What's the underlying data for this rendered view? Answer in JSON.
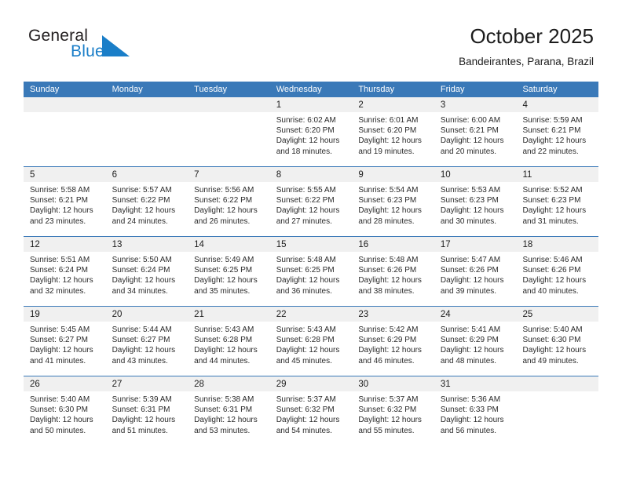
{
  "brand": {
    "word_one": "General",
    "word_two": "Blue",
    "triangle_color": "#1a7ec8"
  },
  "header": {
    "title": "October 2025",
    "subtitle": "Bandeirantes, Parana, Brazil"
  },
  "theme": {
    "header_blue": "#3a79b8",
    "day_band_gray": "#f0f0f0",
    "text_dark": "#1c1c1c"
  },
  "weekdays": [
    "Sunday",
    "Monday",
    "Tuesday",
    "Wednesday",
    "Thursday",
    "Friday",
    "Saturday"
  ],
  "weeks": [
    [
      {
        "empty": true
      },
      {
        "empty": true
      },
      {
        "empty": true
      },
      {
        "day": "1",
        "sunrise": "Sunrise: 6:02 AM",
        "sunset": "Sunset: 6:20 PM",
        "daylight1": "Daylight: 12 hours",
        "daylight2": "and 18 minutes."
      },
      {
        "day": "2",
        "sunrise": "Sunrise: 6:01 AM",
        "sunset": "Sunset: 6:20 PM",
        "daylight1": "Daylight: 12 hours",
        "daylight2": "and 19 minutes."
      },
      {
        "day": "3",
        "sunrise": "Sunrise: 6:00 AM",
        "sunset": "Sunset: 6:21 PM",
        "daylight1": "Daylight: 12 hours",
        "daylight2": "and 20 minutes."
      },
      {
        "day": "4",
        "sunrise": "Sunrise: 5:59 AM",
        "sunset": "Sunset: 6:21 PM",
        "daylight1": "Daylight: 12 hours",
        "daylight2": "and 22 minutes."
      }
    ],
    [
      {
        "day": "5",
        "sunrise": "Sunrise: 5:58 AM",
        "sunset": "Sunset: 6:21 PM",
        "daylight1": "Daylight: 12 hours",
        "daylight2": "and 23 minutes."
      },
      {
        "day": "6",
        "sunrise": "Sunrise: 5:57 AM",
        "sunset": "Sunset: 6:22 PM",
        "daylight1": "Daylight: 12 hours",
        "daylight2": "and 24 minutes."
      },
      {
        "day": "7",
        "sunrise": "Sunrise: 5:56 AM",
        "sunset": "Sunset: 6:22 PM",
        "daylight1": "Daylight: 12 hours",
        "daylight2": "and 26 minutes."
      },
      {
        "day": "8",
        "sunrise": "Sunrise: 5:55 AM",
        "sunset": "Sunset: 6:22 PM",
        "daylight1": "Daylight: 12 hours",
        "daylight2": "and 27 minutes."
      },
      {
        "day": "9",
        "sunrise": "Sunrise: 5:54 AM",
        "sunset": "Sunset: 6:23 PM",
        "daylight1": "Daylight: 12 hours",
        "daylight2": "and 28 minutes."
      },
      {
        "day": "10",
        "sunrise": "Sunrise: 5:53 AM",
        "sunset": "Sunset: 6:23 PM",
        "daylight1": "Daylight: 12 hours",
        "daylight2": "and 30 minutes."
      },
      {
        "day": "11",
        "sunrise": "Sunrise: 5:52 AM",
        "sunset": "Sunset: 6:23 PM",
        "daylight1": "Daylight: 12 hours",
        "daylight2": "and 31 minutes."
      }
    ],
    [
      {
        "day": "12",
        "sunrise": "Sunrise: 5:51 AM",
        "sunset": "Sunset: 6:24 PM",
        "daylight1": "Daylight: 12 hours",
        "daylight2": "and 32 minutes."
      },
      {
        "day": "13",
        "sunrise": "Sunrise: 5:50 AM",
        "sunset": "Sunset: 6:24 PM",
        "daylight1": "Daylight: 12 hours",
        "daylight2": "and 34 minutes."
      },
      {
        "day": "14",
        "sunrise": "Sunrise: 5:49 AM",
        "sunset": "Sunset: 6:25 PM",
        "daylight1": "Daylight: 12 hours",
        "daylight2": "and 35 minutes."
      },
      {
        "day": "15",
        "sunrise": "Sunrise: 5:48 AM",
        "sunset": "Sunset: 6:25 PM",
        "daylight1": "Daylight: 12 hours",
        "daylight2": "and 36 minutes."
      },
      {
        "day": "16",
        "sunrise": "Sunrise: 5:48 AM",
        "sunset": "Sunset: 6:26 PM",
        "daylight1": "Daylight: 12 hours",
        "daylight2": "and 38 minutes."
      },
      {
        "day": "17",
        "sunrise": "Sunrise: 5:47 AM",
        "sunset": "Sunset: 6:26 PM",
        "daylight1": "Daylight: 12 hours",
        "daylight2": "and 39 minutes."
      },
      {
        "day": "18",
        "sunrise": "Sunrise: 5:46 AM",
        "sunset": "Sunset: 6:26 PM",
        "daylight1": "Daylight: 12 hours",
        "daylight2": "and 40 minutes."
      }
    ],
    [
      {
        "day": "19",
        "sunrise": "Sunrise: 5:45 AM",
        "sunset": "Sunset: 6:27 PM",
        "daylight1": "Daylight: 12 hours",
        "daylight2": "and 41 minutes."
      },
      {
        "day": "20",
        "sunrise": "Sunrise: 5:44 AM",
        "sunset": "Sunset: 6:27 PM",
        "daylight1": "Daylight: 12 hours",
        "daylight2": "and 43 minutes."
      },
      {
        "day": "21",
        "sunrise": "Sunrise: 5:43 AM",
        "sunset": "Sunset: 6:28 PM",
        "daylight1": "Daylight: 12 hours",
        "daylight2": "and 44 minutes."
      },
      {
        "day": "22",
        "sunrise": "Sunrise: 5:43 AM",
        "sunset": "Sunset: 6:28 PM",
        "daylight1": "Daylight: 12 hours",
        "daylight2": "and 45 minutes."
      },
      {
        "day": "23",
        "sunrise": "Sunrise: 5:42 AM",
        "sunset": "Sunset: 6:29 PM",
        "daylight1": "Daylight: 12 hours",
        "daylight2": "and 46 minutes."
      },
      {
        "day": "24",
        "sunrise": "Sunrise: 5:41 AM",
        "sunset": "Sunset: 6:29 PM",
        "daylight1": "Daylight: 12 hours",
        "daylight2": "and 48 minutes."
      },
      {
        "day": "25",
        "sunrise": "Sunrise: 5:40 AM",
        "sunset": "Sunset: 6:30 PM",
        "daylight1": "Daylight: 12 hours",
        "daylight2": "and 49 minutes."
      }
    ],
    [
      {
        "day": "26",
        "sunrise": "Sunrise: 5:40 AM",
        "sunset": "Sunset: 6:30 PM",
        "daylight1": "Daylight: 12 hours",
        "daylight2": "and 50 minutes."
      },
      {
        "day": "27",
        "sunrise": "Sunrise: 5:39 AM",
        "sunset": "Sunset: 6:31 PM",
        "daylight1": "Daylight: 12 hours",
        "daylight2": "and 51 minutes."
      },
      {
        "day": "28",
        "sunrise": "Sunrise: 5:38 AM",
        "sunset": "Sunset: 6:31 PM",
        "daylight1": "Daylight: 12 hours",
        "daylight2": "and 53 minutes."
      },
      {
        "day": "29",
        "sunrise": "Sunrise: 5:37 AM",
        "sunset": "Sunset: 6:32 PM",
        "daylight1": "Daylight: 12 hours",
        "daylight2": "and 54 minutes."
      },
      {
        "day": "30",
        "sunrise": "Sunrise: 5:37 AM",
        "sunset": "Sunset: 6:32 PM",
        "daylight1": "Daylight: 12 hours",
        "daylight2": "and 55 minutes."
      },
      {
        "day": "31",
        "sunrise": "Sunrise: 5:36 AM",
        "sunset": "Sunset: 6:33 PM",
        "daylight1": "Daylight: 12 hours",
        "daylight2": "and 56 minutes."
      },
      {
        "empty": true
      }
    ]
  ]
}
